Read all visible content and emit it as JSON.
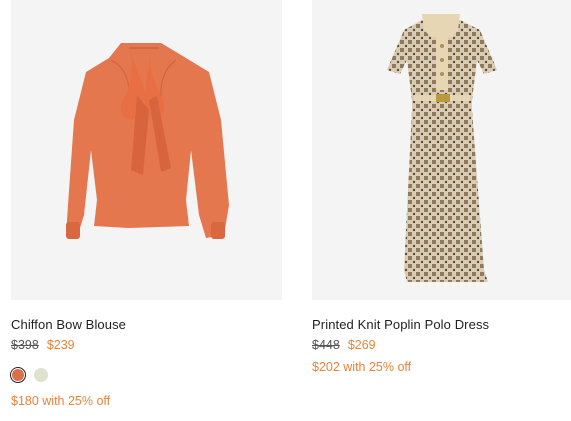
{
  "products": [
    {
      "name": "Chiffon Bow Blouse",
      "original_price": "$398",
      "sale_price": "$239",
      "promo": "$180 with 25% off",
      "swatches": [
        {
          "color": "#d9704a",
          "selected": true
        },
        {
          "color": "#dfe3cc",
          "selected": false
        }
      ]
    },
    {
      "name": "Printed Knit Poplin Polo Dress",
      "original_price": "$448",
      "sale_price": "$269",
      "promo": "$202 with 25% off"
    }
  ],
  "colors": {
    "sale": "#e8833a",
    "image_bg": "#f4f4f4",
    "blouse": "#e5774f",
    "dress_collar": "#e7d6b4",
    "dress_pattern": "#8f7a5e"
  }
}
